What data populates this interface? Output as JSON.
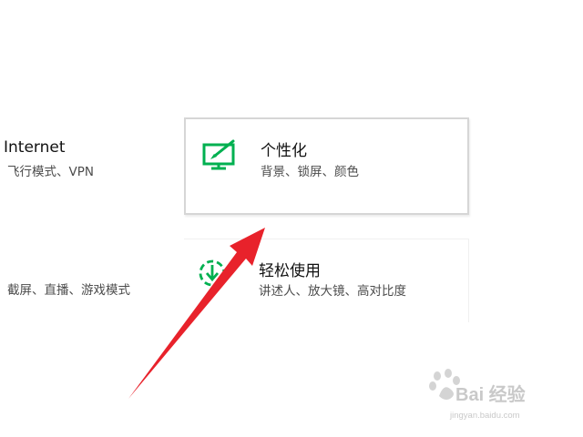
{
  "tiles": {
    "network": {
      "title": "Internet",
      "subtitle": "飞行模式、VPN"
    },
    "gaming": {
      "subtitle": "截屏、直播、游戏模式"
    },
    "personalization": {
      "title": "个性化",
      "subtitle": "背景、锁屏、颜色",
      "icon": "paintbrush-monitor-icon"
    },
    "ease_of_access": {
      "title": "轻松使用",
      "subtitle": "讲述人、放大镜、高对比度",
      "icon": "ease-of-access-icon"
    }
  },
  "colors": {
    "accent": "#00b050",
    "annotation_arrow": "#e8222b"
  },
  "watermark": {
    "logo": "Bai 经验",
    "site": "jingyan.baidu.com"
  }
}
